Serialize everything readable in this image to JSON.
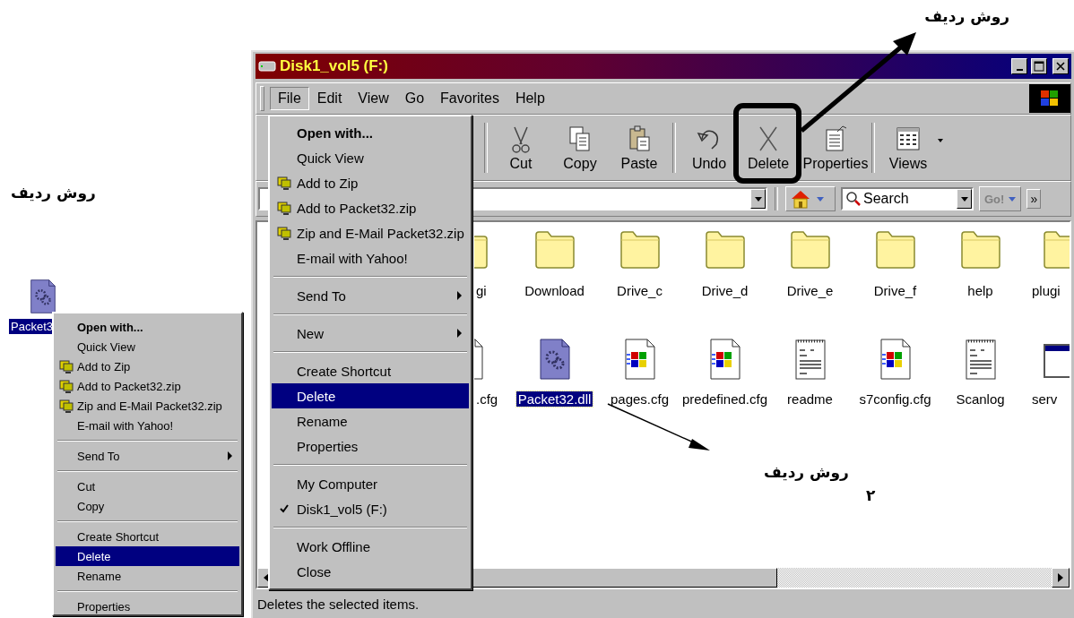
{
  "callouts": [
    {
      "text": "روش ردیف"
    },
    {
      "text": "روش ردیف"
    },
    {
      "text": "روش ردیف",
      "number": "۲"
    }
  ],
  "desktop_icon": {
    "label": "Packet3",
    "selected": true
  },
  "context_menu": {
    "items": [
      {
        "kind": "item",
        "label": "Open with...",
        "bold": true,
        "selected": false
      },
      {
        "kind": "item",
        "label": "Quick View",
        "selected": false
      },
      {
        "kind": "item",
        "label": "Add to Zip",
        "icon": true,
        "selected": false
      },
      {
        "kind": "item",
        "label": "Add to Packet32.zip",
        "icon": true,
        "selected": false
      },
      {
        "kind": "item",
        "label": "Zip and E-Mail Packet32.zip",
        "icon": true,
        "selected": false
      },
      {
        "kind": "item",
        "label": "E-mail with Yahoo!",
        "selected": false
      },
      {
        "kind": "separator"
      },
      {
        "kind": "item",
        "label": "Send To",
        "submenu": true,
        "selected": false
      },
      {
        "kind": "separator"
      },
      {
        "kind": "item",
        "label": "Cut",
        "selected": false
      },
      {
        "kind": "item",
        "label": "Copy",
        "selected": false
      },
      {
        "kind": "separator"
      },
      {
        "kind": "item",
        "label": "Create Shortcut",
        "selected": false
      },
      {
        "kind": "item",
        "label": "Delete",
        "selected": true
      },
      {
        "kind": "item",
        "label": "Rename",
        "selected": false
      },
      {
        "kind": "separator"
      },
      {
        "kind": "item",
        "label": "Properties",
        "selected": false
      }
    ]
  },
  "window": {
    "title": "Disk1_vol5 (F:)",
    "menu": [
      {
        "label": "File",
        "selected": true
      },
      {
        "label": "Edit",
        "selected": false
      },
      {
        "label": "View",
        "selected": false
      },
      {
        "label": "Go",
        "selected": false
      },
      {
        "label": "Favorites",
        "selected": false
      },
      {
        "label": "Help",
        "selected": false
      }
    ],
    "toolbar": [
      {
        "kind": "cut",
        "label": "Cut"
      },
      {
        "kind": "copy",
        "label": "Copy"
      },
      {
        "kind": "paste",
        "label": "Paste"
      },
      {
        "kind": "undo",
        "label": "Undo"
      },
      {
        "kind": "delete",
        "label": "Delete"
      },
      {
        "kind": "properties",
        "label": "Properties"
      },
      {
        "kind": "views",
        "label": "Views"
      }
    ],
    "search": {
      "value": "Search"
    },
    "go_button": "Go!",
    "chevron": "»",
    "file_menu": {
      "items": [
        {
          "kind": "item",
          "label": "Open with...",
          "bold": true,
          "selected": false,
          "checked": false
        },
        {
          "kind": "item",
          "label": "Quick View",
          "selected": false,
          "checked": false
        },
        {
          "kind": "item",
          "label": "Add to Zip",
          "icon": true,
          "selected": false,
          "checked": false
        },
        {
          "kind": "item",
          "label": "Add to Packet32.zip",
          "icon": true,
          "selected": false,
          "checked": false
        },
        {
          "kind": "item",
          "label": "Zip and E-Mail Packet32.zip",
          "icon": true,
          "selected": false,
          "checked": false
        },
        {
          "kind": "item",
          "label": "E-mail with Yahoo!",
          "selected": false,
          "checked": false
        },
        {
          "kind": "separator"
        },
        {
          "kind": "item",
          "label": "Send To",
          "submenu": true,
          "selected": false,
          "checked": false
        },
        {
          "kind": "separator"
        },
        {
          "kind": "item",
          "label": "New",
          "submenu": true,
          "selected": false,
          "checked": false
        },
        {
          "kind": "separator"
        },
        {
          "kind": "item",
          "label": "Create Shortcut",
          "selected": false,
          "checked": false
        },
        {
          "kind": "item",
          "label": "Delete",
          "selected": true,
          "checked": false
        },
        {
          "kind": "item",
          "label": "Rename",
          "selected": false,
          "checked": false
        },
        {
          "kind": "item",
          "label": "Properties",
          "selected": false,
          "checked": false
        },
        {
          "kind": "separator"
        },
        {
          "kind": "item",
          "label": "My Computer",
          "selected": false,
          "checked": false
        },
        {
          "kind": "item",
          "label": "Disk1_vol5 (F:)",
          "selected": false,
          "checked": true
        },
        {
          "kind": "separator"
        },
        {
          "kind": "item",
          "label": "Work Offline",
          "selected": false,
          "checked": false
        },
        {
          "kind": "item",
          "label": "Close",
          "selected": false,
          "checked": false
        }
      ]
    },
    "files": [
      [
        {
          "name": "gi",
          "kind": "folder",
          "selected": false
        },
        {
          "name": "Download",
          "kind": "folder",
          "selected": false
        },
        {
          "name": "Drive_c",
          "kind": "folder",
          "selected": false
        },
        {
          "name": "Drive_d",
          "kind": "folder",
          "selected": false
        },
        {
          "name": "Drive_e",
          "kind": "folder",
          "selected": false
        },
        {
          "name": "Drive_f",
          "kind": "folder",
          "selected": false
        },
        {
          "name": "help",
          "kind": "folder",
          "selected": false
        },
        {
          "name": "plugi",
          "kind": "folder",
          "selected": false
        }
      ],
      [
        {
          "name": ".cfg",
          "kind": "config",
          "selected": false
        },
        {
          "name": "Packet32.dll",
          "kind": "dll",
          "selected": true
        },
        {
          "name": "pages.cfg",
          "kind": "config",
          "selected": false
        },
        {
          "name": "predefined.cfg",
          "kind": "config",
          "selected": false
        },
        {
          "name": "readme",
          "kind": "text",
          "selected": false
        },
        {
          "name": "s7config.cfg",
          "kind": "config",
          "selected": false
        },
        {
          "name": "Scanlog",
          "kind": "text",
          "selected": false
        },
        {
          "name": "serv",
          "kind": "app",
          "selected": false
        }
      ]
    ],
    "status_bar": "Deletes the selected items."
  }
}
